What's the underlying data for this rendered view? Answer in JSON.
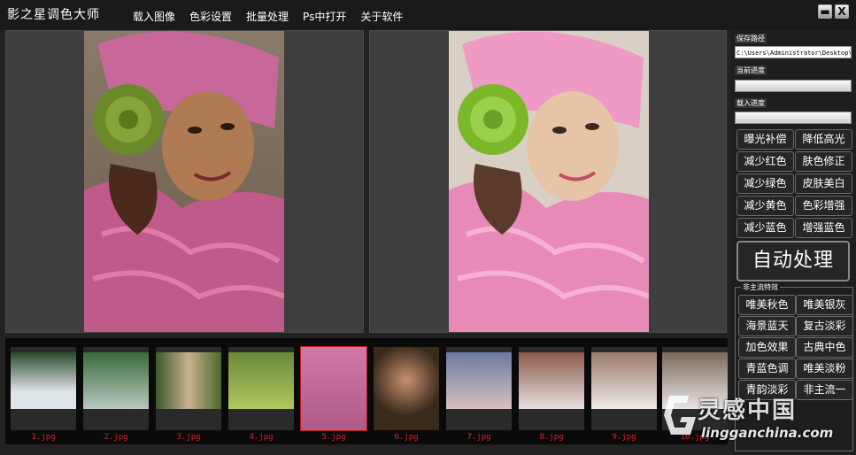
{
  "app": {
    "title": "影之星调色大师"
  },
  "menu": [
    "载入图像",
    "色彩设置",
    "批量处理",
    "Ps中打开",
    "关于软件"
  ],
  "window_buttons": {
    "minimize": "▬",
    "close": "X"
  },
  "sidebar": {
    "save_path_label": "保存路径",
    "save_path_value": "C:\\Users\\Administrator\\Desktop\\",
    "current_progress_label": "当前进度",
    "current_progress": 0,
    "load_progress_label": "载入进度",
    "load_progress": 0,
    "adjust_buttons": [
      [
        "曝光补偿",
        "降低高光"
      ],
      [
        "减少红色",
        "肤色修正"
      ],
      [
        "减少绿色",
        "皮肤美白"
      ],
      [
        "减少黄色",
        "色彩增强"
      ],
      [
        "减少蓝色",
        "增强蓝色"
      ]
    ],
    "auto_button": "自动处理",
    "style_group_label": "非主流特效",
    "style_buttons": [
      [
        "唯美秋色",
        "唯美银灰"
      ],
      [
        "海景蓝天",
        "复古淡彩"
      ],
      [
        "加色效果",
        "古典中色"
      ],
      [
        "青蓝色调",
        "唯美淡粉"
      ],
      [
        "青韵淡彩",
        "非主流一"
      ]
    ]
  },
  "thumbnails": [
    "1.jpg",
    "2.jpg",
    "3.jpg",
    "4.jpg",
    "5.jpg",
    "6.jpg",
    "7.jpg",
    "8.jpg",
    "9.jpg",
    "10.jpg"
  ],
  "selected_thumbnail": "5.jpg",
  "watermark": {
    "cn": "灵感中国",
    "en": "lingganchina.com"
  },
  "colors": {
    "accent_red": "#d22222",
    "background": "#202020",
    "panel": "#3e3e3e"
  }
}
